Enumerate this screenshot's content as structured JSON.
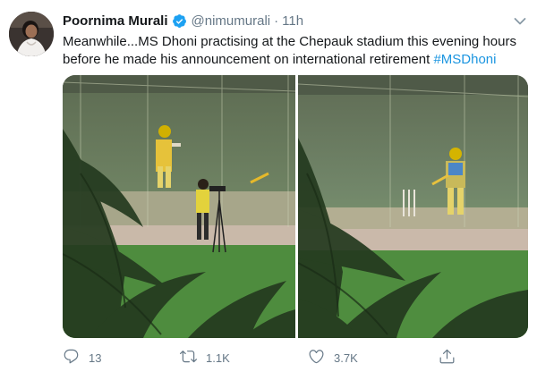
{
  "author": {
    "name": "Poornima Murali",
    "handle": "@nimumurali",
    "separator": "·",
    "time": "11h"
  },
  "tweet": {
    "text": "Meanwhile...MS Dhoni practising at the Chepauk stadium this evening hours before he made his announcement on international retirement ",
    "hashtag": "#MSDhoni"
  },
  "actions": {
    "replies": "13",
    "retweets": "1.1K",
    "likes": "3.7K"
  },
  "icons": {
    "verified": "verified-badge-icon",
    "caret": "chevron-down-icon",
    "reply": "reply-icon",
    "retweet": "retweet-icon",
    "like": "heart-icon",
    "share": "share-icon"
  },
  "colors": {
    "text": "#14171a",
    "secondary": "#657786",
    "link": "#1b95e0",
    "verified": "#1da1f2"
  }
}
